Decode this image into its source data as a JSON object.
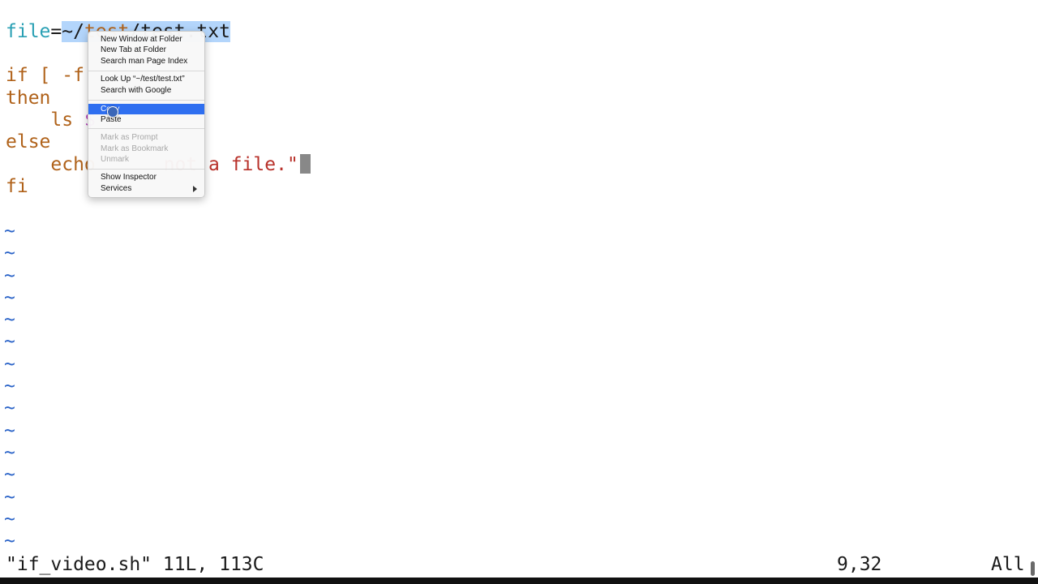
{
  "editor": {
    "lines": {
      "l1": {
        "var": "file",
        "eq": "=",
        "path_a": "~/",
        "path_b": "test",
        "path_c": "/test.txt"
      },
      "l3": {
        "kw": "if",
        "rest": " [ -f "
      },
      "l4": {
        "kw": "then"
      },
      "l5": {
        "indent": "    ",
        "cmd": "ls ",
        "dollar": "$"
      },
      "l6": {
        "kw": "else"
      },
      "l7": {
        "indent": "    ",
        "cmd": "echo",
        "str_tail": " not a file.\""
      },
      "l8": {
        "kw": "fi"
      }
    },
    "tilde": "~"
  },
  "statusbar": {
    "file_info": "\"if_video.sh\" 11L, 113C",
    "position": "9,32",
    "scroll": "All"
  },
  "context_menu": {
    "new_window_at_folder": "New Window at Folder",
    "new_tab_at_folder": "New Tab at Folder",
    "search_man_page_index": "Search man Page Index",
    "look_up": "Look Up “~/test/test.txt”",
    "search_with_google": "Search with Google",
    "copy": "Copy",
    "paste": "Paste",
    "mark_as_prompt": "Mark as Prompt",
    "mark_as_bookmark": "Mark as Bookmark",
    "unmark": "Unmark",
    "show_inspector": "Show Inspector",
    "services": "Services"
  },
  "icons": {
    "submenu_arrow": "chevron-right-icon",
    "pointer": "mouse-pointer-icon"
  },
  "colors": {
    "menu_highlight": "#2f6ff0",
    "selection": "#b3d5fb",
    "tilde": "#2a63c8",
    "keyword": "#b0621a",
    "variable": "#2aa0b4",
    "string": "#b8312a"
  }
}
